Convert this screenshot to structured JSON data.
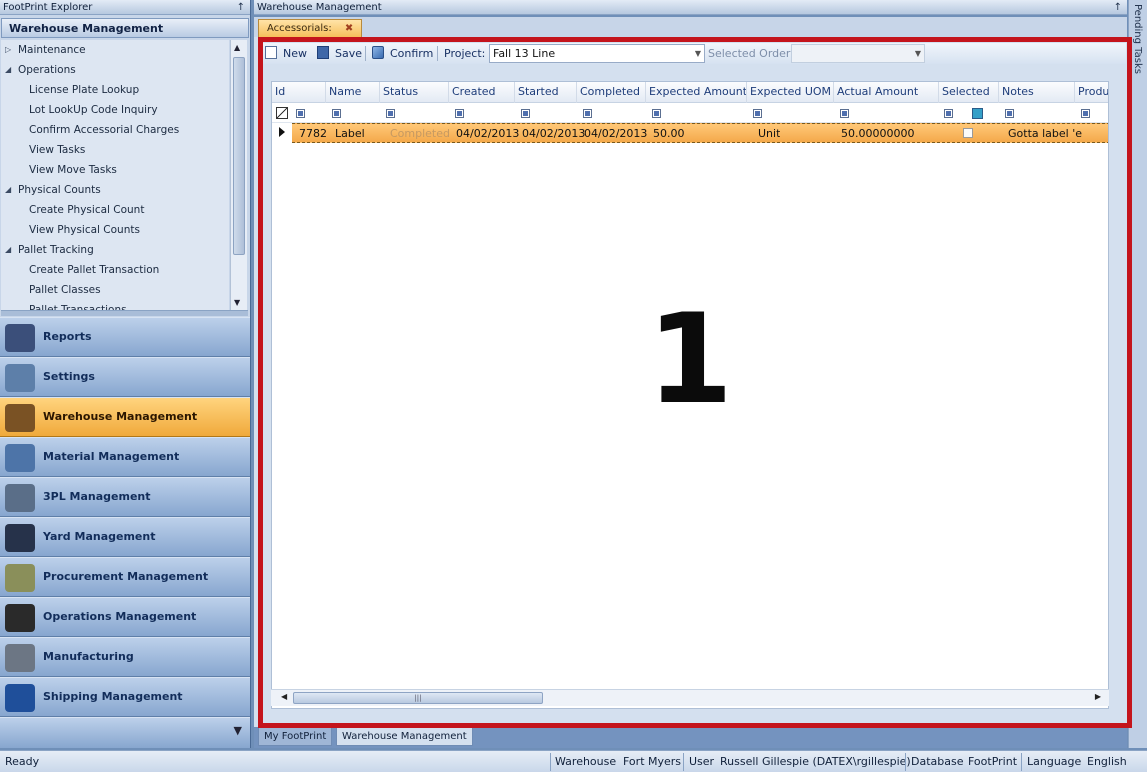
{
  "explorer": {
    "title": "FootPrint Explorer",
    "pin": "↑",
    "group_title": "Warehouse Management",
    "tree": [
      {
        "label": "Maintenance",
        "level": 0,
        "arrow": "▷"
      },
      {
        "label": "Operations",
        "level": 0,
        "arrow": "◢"
      },
      {
        "label": "License Plate Lookup",
        "level": 1
      },
      {
        "label": "Lot LookUp Code Inquiry",
        "level": 1
      },
      {
        "label": "Confirm Accessorial Charges",
        "level": 1
      },
      {
        "label": "View Tasks",
        "level": 1
      },
      {
        "label": "View Move Tasks",
        "level": 1
      },
      {
        "label": "Physical Counts",
        "level": 0,
        "arrow": "◢"
      },
      {
        "label": "Create Physical Count",
        "level": 1
      },
      {
        "label": "View Physical Counts",
        "level": 1
      },
      {
        "label": "Pallet Tracking",
        "level": 0,
        "arrow": "◢"
      },
      {
        "label": "Create Pallet Transaction",
        "level": 1
      },
      {
        "label": "Pallet Classes",
        "level": 1
      },
      {
        "label": "Pallet Transactions",
        "level": 1
      }
    ],
    "nav": [
      {
        "label": "Reports",
        "icon": "reports-icon",
        "color": "#3b4f7a",
        "active": false
      },
      {
        "label": "Settings",
        "icon": "settings-icon",
        "color": "#5d7fa9",
        "active": false
      },
      {
        "label": "Warehouse Management",
        "icon": "warehouse-icon",
        "color": "#7a5224",
        "active": true
      },
      {
        "label": "Material Management",
        "icon": "material-icon",
        "color": "#4d74a8",
        "active": false
      },
      {
        "label": "3PL Management",
        "icon": "3pl-icon",
        "color": "#5a6e88",
        "active": false
      },
      {
        "label": "Yard Management",
        "icon": "yard-icon",
        "color": "#26324a",
        "active": false
      },
      {
        "label": "Procurement Management",
        "icon": "procurement-icon",
        "color": "#8a8f5a",
        "active": false
      },
      {
        "label": "Operations Management",
        "icon": "operations-icon",
        "color": "#2a2a2a",
        "active": false
      },
      {
        "label": "Manufacturing",
        "icon": "manufacturing-icon",
        "color": "#6c7684",
        "active": false
      },
      {
        "label": "Shipping Management",
        "icon": "shipping-icon",
        "color": "#1f4f9a",
        "active": false
      }
    ]
  },
  "main": {
    "title": "Warehouse Management",
    "pin": "↑",
    "doc_tab": {
      "label": "Accessorials:",
      "close": "✖"
    },
    "pending_tasks": "Pending Tasks"
  },
  "toolbar": {
    "new_label": "New",
    "save_label": "Save",
    "confirm_label": "Confirm",
    "project_label": "Project:",
    "project_value": "Fall 13 Line",
    "selected_order_label": "Selected Order:",
    "selected_order_value": ""
  },
  "grid": {
    "columns": [
      "Id",
      "Name",
      "Status",
      "Created",
      "Started",
      "Completed",
      "Expected Amount",
      "Expected UOM",
      "Actual Amount",
      "Selected",
      "Notes",
      "Produ"
    ],
    "rows": [
      {
        "id": "7782",
        "name": "Label",
        "status": "Completed",
        "created": "04/02/2013",
        "started": "04/02/2013",
        "completed": "04/02/2013",
        "expected_amount": "50.00",
        "expected_uom": "Unit",
        "actual_amount": "50.00000000",
        "selected": false,
        "notes": "Gotta label 'e"
      }
    ]
  },
  "overlay_number": "1",
  "bottom_tabs": {
    "tab1": "My FootPrint",
    "tab2": "Warehouse Management"
  },
  "status": {
    "ready": "Ready",
    "warehouse_label": "Warehouse",
    "warehouse_value": "Fort Myers",
    "user_label": "User",
    "user_value": "Russell Gillespie (DATEX\\rgillespie)",
    "database_label": "Database",
    "database_value": "FootPrint",
    "language_label": "Language",
    "language_value": "English"
  }
}
